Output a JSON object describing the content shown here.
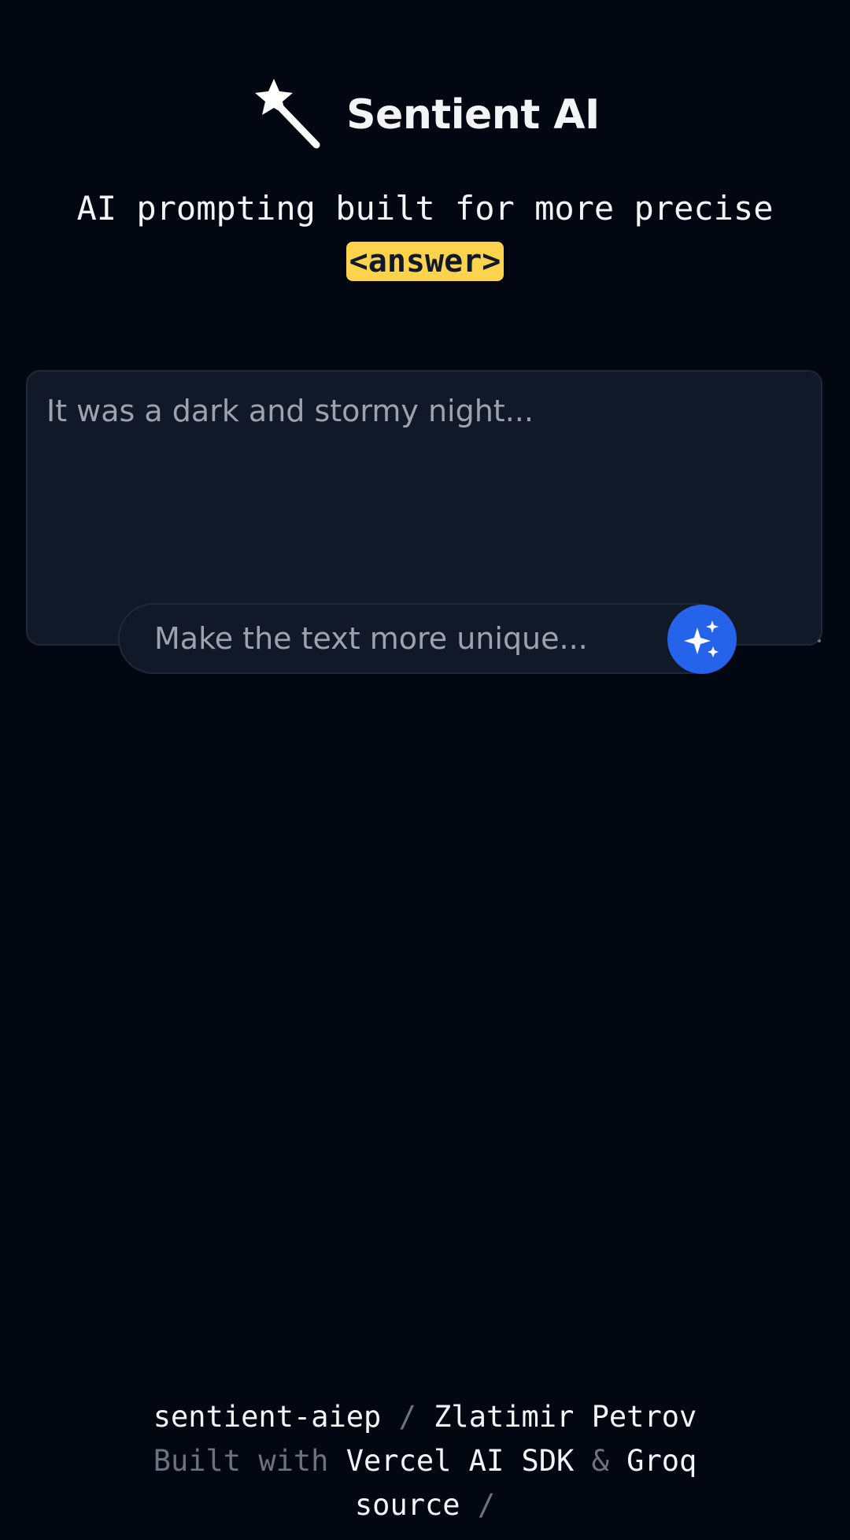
{
  "header": {
    "title": "Sentient AI",
    "logo_icon": "magic-wand-icon"
  },
  "tagline": {
    "line1": "AI prompting built for more precise",
    "highlight": "<answer>",
    "highlight_color": "#fcd34d"
  },
  "editor": {
    "text": "It was a dark and stormy night..."
  },
  "prompt": {
    "placeholder": "Make the text more unique...",
    "submit_icon": "sparkles-icon",
    "submit_color": "#2563eb"
  },
  "footer": {
    "repo_link": "sentient-aiep",
    "separator1": " / ",
    "author_link": "Zlatimir Petrov",
    "built_with_label": "Built with ",
    "sdk_link": "Vercel AI SDK",
    "ampersand": " & ",
    "groq_link": "Groq",
    "source_link": "source",
    "separator2": " /"
  }
}
